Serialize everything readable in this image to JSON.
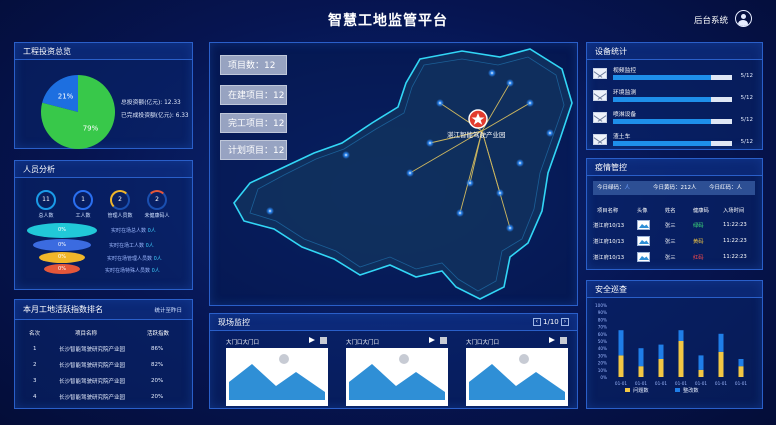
{
  "header": {
    "title": "智慧工地监管平台",
    "admin_label": "后台系统"
  },
  "investment": {
    "title": "工程投资总览",
    "pie": [
      {
        "label": "21%",
        "value": 21,
        "color": "#1d6fe0"
      },
      {
        "label": "79%",
        "value": 79,
        "color": "#38c84a"
      }
    ],
    "stats": [
      "总投资额(亿元): 12.33",
      "已完成投资额(亿元): 6.33"
    ]
  },
  "staff": {
    "title": "人员分析",
    "rings": [
      {
        "value": "11",
        "label": "总人数"
      },
      {
        "value": "1",
        "label": "工人数"
      },
      {
        "value": "2",
        "label": "管理人员数"
      },
      {
        "value": "2",
        "label": "未健康码人"
      }
    ],
    "layers": [
      {
        "label": "0%",
        "desc": "实时在场总人数",
        "count": "0人",
        "color": "#21c8d8"
      },
      {
        "label": "0%",
        "desc": "实时在场工人数",
        "count": "0人",
        "color": "#3b6be0"
      },
      {
        "label": "0%",
        "desc": "实时在场管理人员数",
        "count": "0人",
        "color": "#f0b62a"
      },
      {
        "label": "0%",
        "desc": "实时在场特殊人员数",
        "count": "0人",
        "color": "#e5573a"
      }
    ]
  },
  "ranking": {
    "title": "本月工地活跃指数排名",
    "subtitle": "统计至昨日",
    "headers": [
      "名次",
      "项目名称",
      "活跃指数"
    ],
    "rows": [
      [
        "1",
        "长沙智能驾驶研究院产业园",
        "86%"
      ],
      [
        "2",
        "长沙智能驾驶研究院产业园",
        "82%"
      ],
      [
        "3",
        "长沙智能驾驶研究院产业园",
        "20%"
      ],
      [
        "4",
        "长沙智能驾驶研究院产业园",
        "20%"
      ]
    ]
  },
  "map": {
    "stats": [
      {
        "label": "项目数：",
        "value": "12"
      },
      {
        "label": "在建项目：",
        "value": "12"
      },
      {
        "label": "完工项目：",
        "value": "12"
      },
      {
        "label": "计划项目：",
        "value": "12"
      }
    ],
    "center_label": "湛江智能驾驶产业园"
  },
  "cameras": {
    "title": "现场监控",
    "page": "1/10",
    "items": [
      {
        "name": "大门口大门口"
      },
      {
        "name": "大门口大门口"
      },
      {
        "name": "大门口大门口"
      }
    ]
  },
  "devices": {
    "title": "设备统计",
    "items": [
      {
        "name": "视频监控",
        "fill": 0.82,
        "count": "5/12"
      },
      {
        "name": "环境监测",
        "fill": 0.82,
        "count": "5/12"
      },
      {
        "name": "喷淋设备",
        "fill": 0.82,
        "count": "5/12"
      },
      {
        "name": "渣土车",
        "fill": 0.82,
        "count": "5/12"
      }
    ]
  },
  "epidemic": {
    "title": "疫情管控",
    "summary": [
      {
        "label": "今日绿码：",
        "value": "人"
      },
      {
        "label": "今日黄码：",
        "value": "212人"
      },
      {
        "label": "今日红码：",
        "value": "人"
      }
    ],
    "headers": [
      "项目名称",
      "头像",
      "姓名",
      "健康码",
      "入场时间"
    ],
    "rows": [
      {
        "project": "湛江府10/13",
        "name": "张三",
        "code": "绿码",
        "code_class": "green",
        "time": "11:22:23"
      },
      {
        "project": "湛江府10/13",
        "name": "张三",
        "code": "黄码",
        "code_class": "yellow",
        "time": "11:22:23"
      },
      {
        "project": "湛江府10/13",
        "name": "张三",
        "code": "红码",
        "code_class": "red",
        "time": "11:22:23"
      }
    ]
  },
  "security": {
    "title": "安全巡查",
    "chart_data": {
      "type": "bar",
      "categories": [
        "01-01",
        "01-01",
        "01-01",
        "01-01",
        "01-01",
        "01-01",
        "01-01"
      ],
      "series": [
        {
          "name": "问题数",
          "values": [
            30,
            15,
            25,
            50,
            10,
            35,
            15
          ],
          "color": "#f2c744"
        },
        {
          "name": "整改数",
          "values": [
            35,
            25,
            20,
            15,
            20,
            25,
            10
          ],
          "color": "#1f7ee8"
        }
      ],
      "ylim": [
        0,
        100
      ],
      "yticks": [
        "0%",
        "10%",
        "20%",
        "30%",
        "40%",
        "50%",
        "60%",
        "70%",
        "80%",
        "90%",
        "100%"
      ],
      "legend": "bottom"
    }
  }
}
